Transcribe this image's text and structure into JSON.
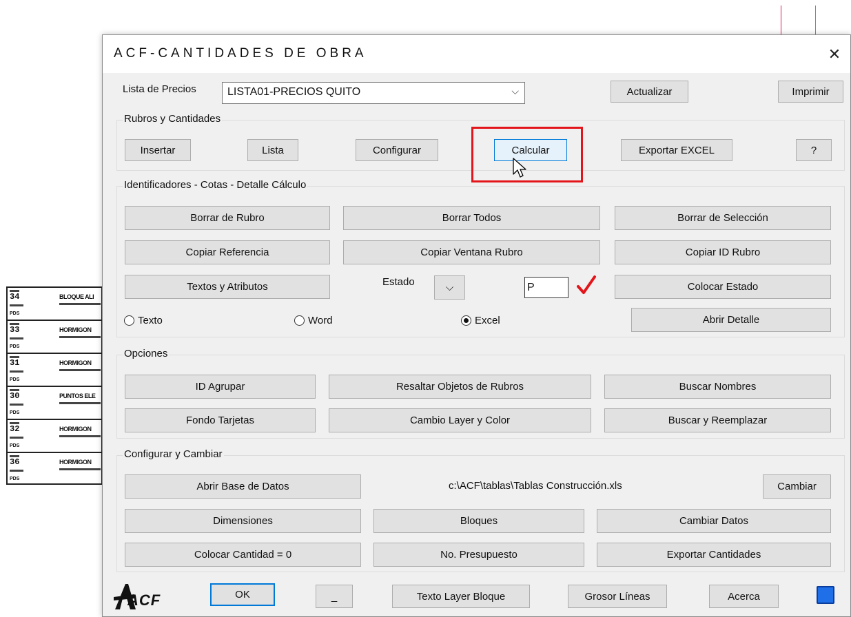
{
  "colors": {
    "highlight": "#e3151a",
    "focus": "#0078d7",
    "bgline_red": "#d81b60",
    "bgline_magenta": "#e040fb",
    "check": "#e3151a",
    "blue_square": "#1e6fe8"
  },
  "cad": {
    "rows": [
      {
        "num": "34",
        "text": "BLOQUE ALI",
        "small": "PDS"
      },
      {
        "num": "33",
        "text": "HORMIGON",
        "small": "PDS"
      },
      {
        "num": "31",
        "text": "HORMIGON",
        "small": "PDS"
      },
      {
        "num": "30",
        "text": "PUNTOS ELE",
        "small": "PDS"
      },
      {
        "num": "32",
        "text": "HORMIGON",
        "small": "PDS"
      },
      {
        "num": "36",
        "text": "HORMIGON",
        "small": "PDS"
      }
    ]
  },
  "dialog": {
    "title": "ACF-CANTIDADES DE OBRA",
    "close": "✕"
  },
  "top": {
    "lista_label": "Lista de Precios",
    "lista_value": "LISTA01-PRECIOS QUITO",
    "combo_arrow": "⌵",
    "actualizar": "Actualizar",
    "imprimir": "Imprimir"
  },
  "rubros": {
    "title": "Rubros y Cantidades",
    "insertar": "Insertar",
    "lista": "Lista",
    "configurar": "Configurar",
    "calcular": "Calcular",
    "exportar": "Exportar EXCEL",
    "help": "?"
  },
  "ident": {
    "title": "Identificadores - Cotas - Detalle Cálculo",
    "borrar_rubro": "Borrar de Rubro",
    "borrar_todos": "Borrar Todos",
    "borrar_seleccion": "Borrar de Selección",
    "copiar_referencia": "Copiar Referencia",
    "copiar_ventana": "Copiar Ventana Rubro",
    "copiar_id": "Copiar ID Rubro",
    "textos_atributos": "Textos y Atributos",
    "estado_label": "Estado",
    "estado_value": "P",
    "colocar_estado": "Colocar Estado",
    "radio_texto": "Texto",
    "radio_word": "Word",
    "radio_excel": "Excel",
    "selected": "Excel",
    "abrir_detalle": "Abrir Detalle"
  },
  "opciones": {
    "title": "Opciones",
    "id_agrupar": "ID Agrupar",
    "resaltar": "Resaltar Objetos de Rubros",
    "buscar_nombres": "Buscar Nombres",
    "fondo": "Fondo Tarjetas",
    "cambio_layer": "Cambio Layer y Color",
    "buscar_reemplazar": "Buscar y Reemplazar"
  },
  "config": {
    "title": "Configurar y Cambiar",
    "abrir_base": "Abrir Base de Datos",
    "path": "c:\\ACF\\tablas\\Tablas Construcción.xls",
    "cambiar": "Cambiar",
    "dimensiones": "Dimensiones",
    "bloques": "Bloques",
    "cambiar_datos": "Cambiar Datos",
    "colocar_cantidad": "Colocar Cantidad = 0",
    "no_presupuesto": "No. Presupuesto",
    "exportar_cantidades": "Exportar Cantidades"
  },
  "bottom": {
    "logo": "ACF",
    "ok": "OK",
    "minimize": "_",
    "texto_layer": "Texto Layer Bloque",
    "grosor": "Grosor Líneas",
    "acerca": "Acerca"
  }
}
